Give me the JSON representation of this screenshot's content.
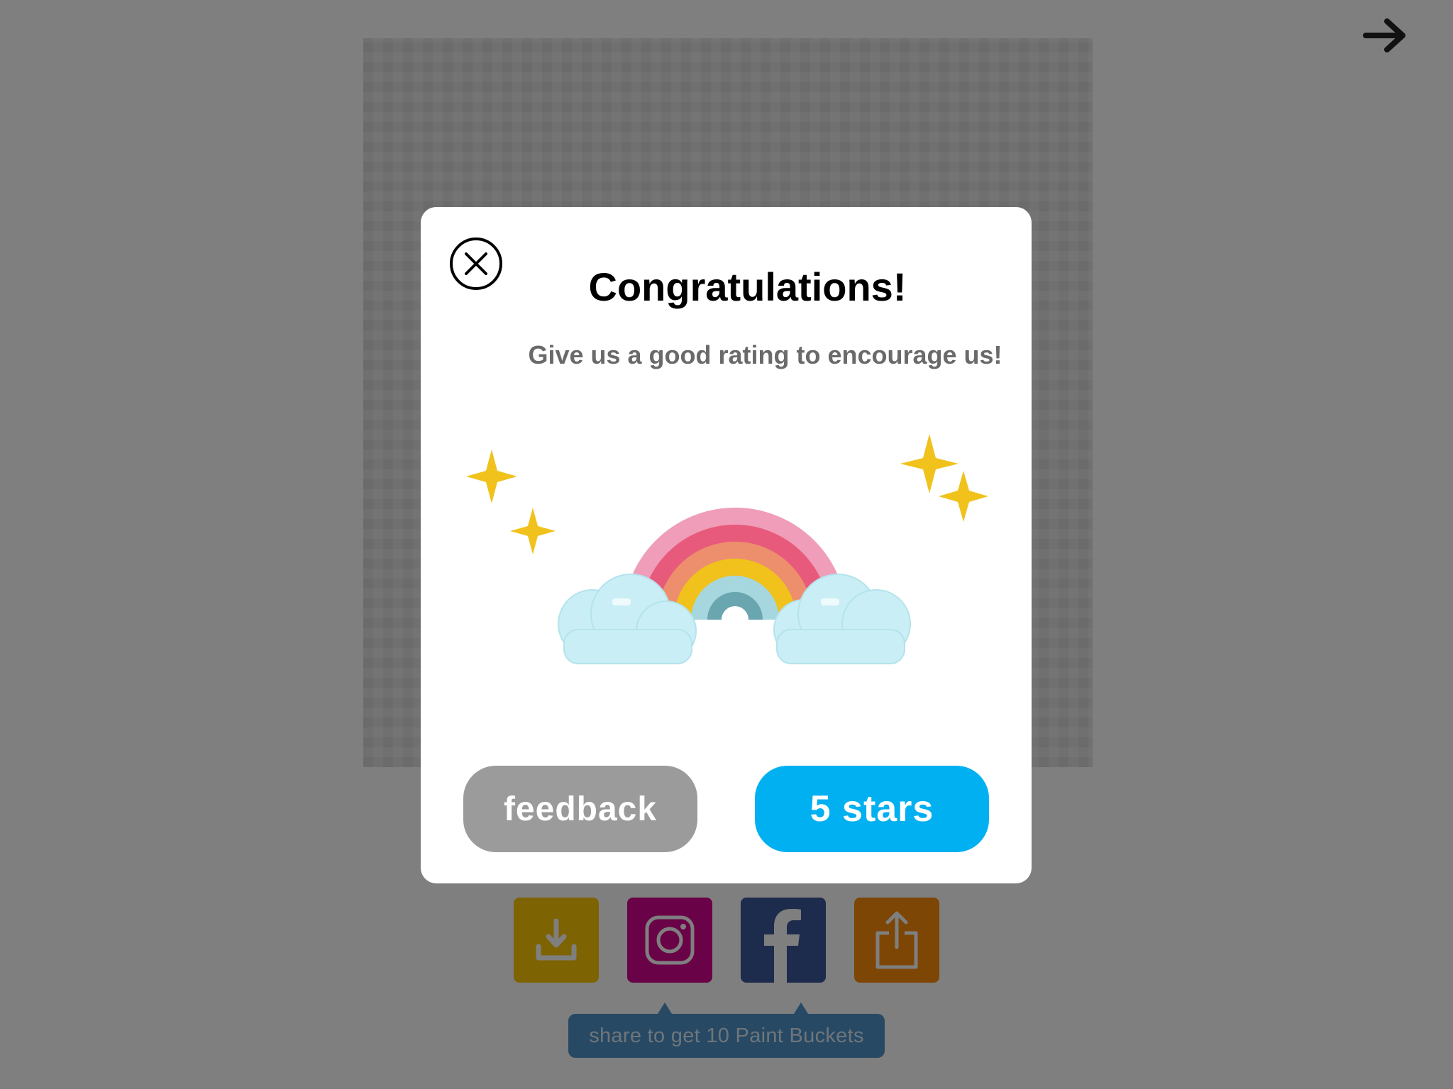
{
  "navigation": {
    "next_icon": "arrow-right-icon"
  },
  "share_bar": {
    "buttons": [
      {
        "name": "download",
        "icon": "download-icon",
        "color": "#fcc605"
      },
      {
        "name": "instagram",
        "icon": "instagram-icon",
        "color": "#d4048f"
      },
      {
        "name": "facebook",
        "icon": "facebook-icon",
        "color": "#3b5798"
      },
      {
        "name": "share",
        "icon": "share-icon",
        "color": "#fb8d0b"
      }
    ],
    "tooltip": "share to get 10 Paint Buckets"
  },
  "dialog": {
    "close_icon": "close-circle-icon",
    "title": "Congratulations!",
    "subtitle": "Give us a good rating to encourage us!",
    "illustration": "pixel-rainbow-clouds-sparkles",
    "feedback_label": "feedback",
    "stars_label": "5 stars",
    "colors": {
      "feedback_bg": "#9b9b9b",
      "stars_bg": "#00b0f0"
    }
  }
}
